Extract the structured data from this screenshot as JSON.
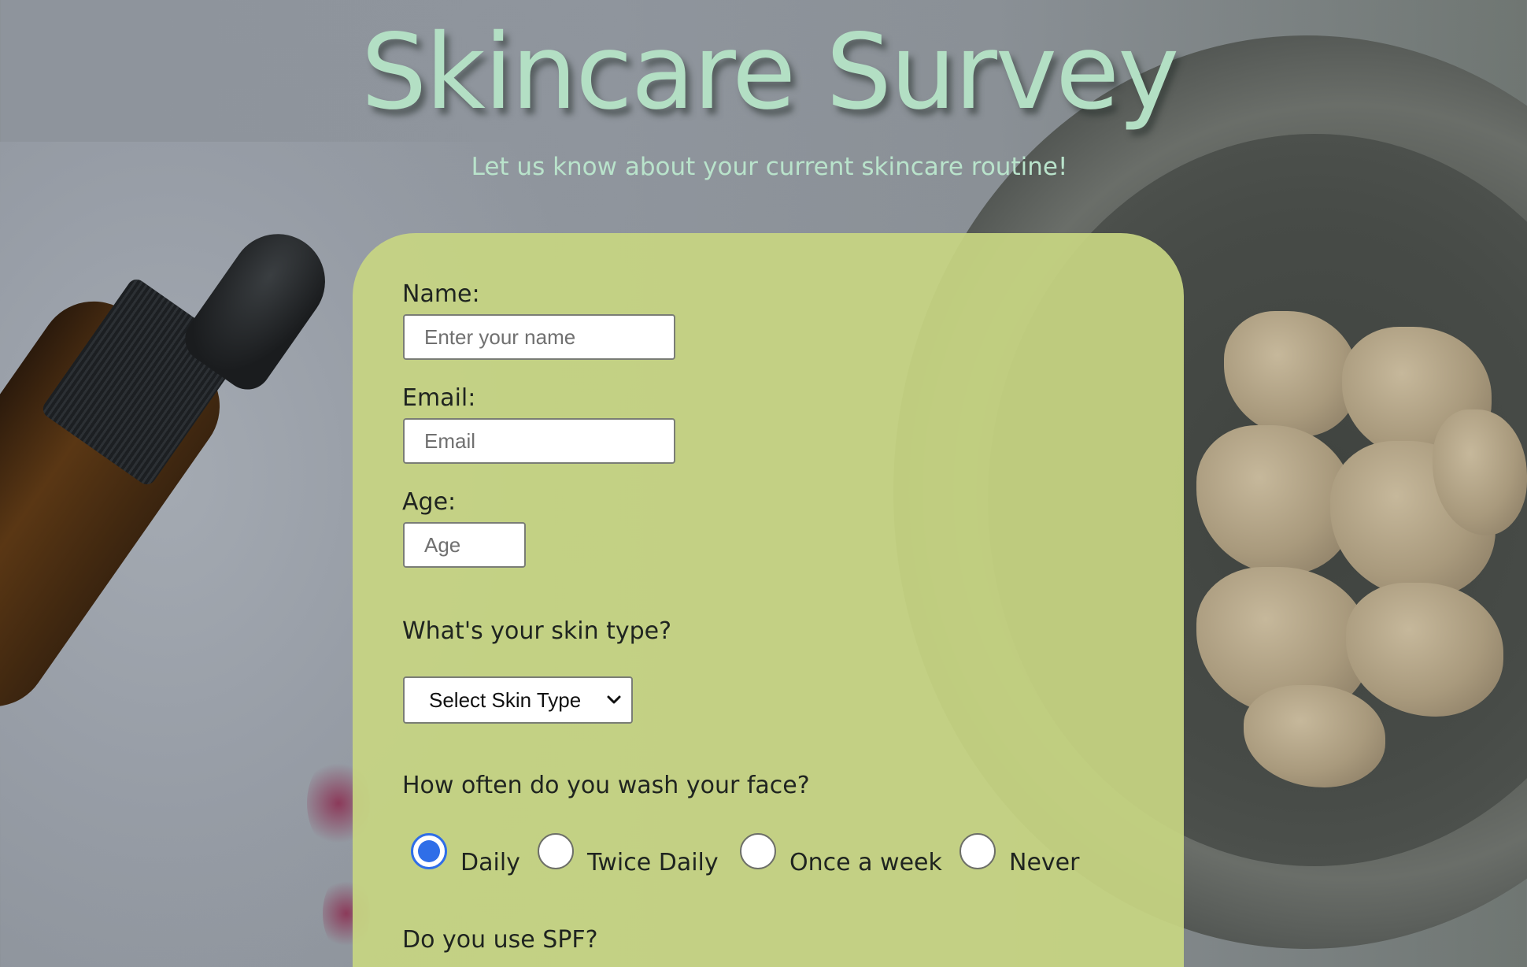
{
  "header": {
    "title": "Skincare Survey",
    "subtitle": "Let us know about your current skincare routine!"
  },
  "form": {
    "name": {
      "label": "Name:",
      "placeholder": "Enter your name",
      "value": ""
    },
    "email": {
      "label": "Email:",
      "placeholder": "Email",
      "value": ""
    },
    "age": {
      "label": "Age:",
      "placeholder": "Age",
      "value": ""
    },
    "skin_type": {
      "question": "What's your skin type?",
      "selected": "Select Skin Type"
    },
    "wash_frequency": {
      "question": "How often do you wash your face?",
      "options": [
        "Daily",
        "Twice Daily",
        "Once a week",
        "Never"
      ],
      "selected": "Daily"
    },
    "spf": {
      "question": "Do you use SPF?"
    }
  },
  "colors": {
    "title": "#b3dfc4",
    "form_background": "#c7d582",
    "radio_checked": "#2f6ee8"
  },
  "icons": {
    "select_arrow": "chevron-down-icon"
  }
}
